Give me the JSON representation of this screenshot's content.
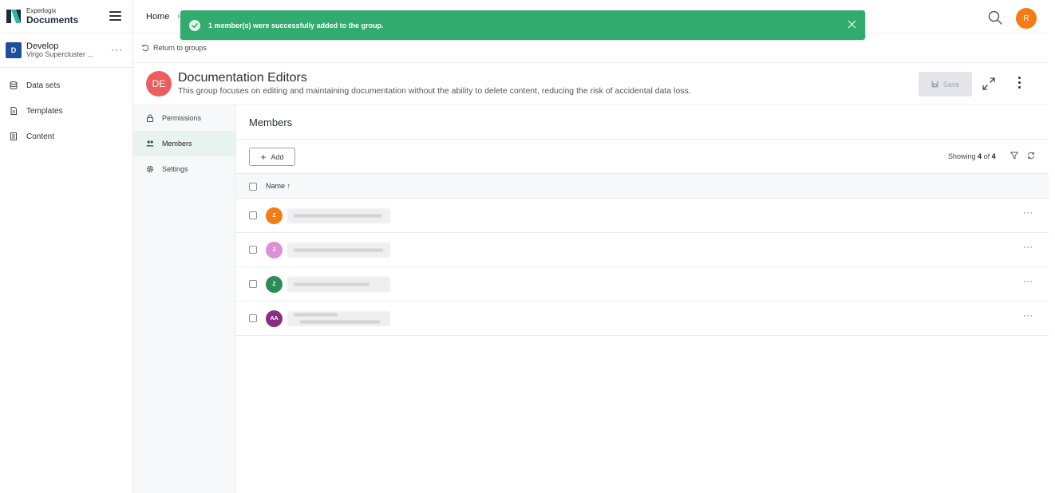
{
  "app": {
    "brand_small": "Experlogix",
    "brand_big": "Documents"
  },
  "workspace": {
    "badge": "D",
    "name": "Develop",
    "subtitle": "Virgo Supercluster ...",
    "more": "···"
  },
  "sidebar": {
    "items": [
      {
        "label": "Data sets",
        "icon": "database-icon"
      },
      {
        "label": "Templates",
        "icon": "document-icon"
      },
      {
        "label": "Content",
        "icon": "content-list-icon"
      }
    ]
  },
  "topbar": {
    "home_label": "Home",
    "home_sep": "›",
    "user_initial": "R",
    "user_color": "#f47b16"
  },
  "toast": {
    "message": "1 member(s) were successfully added to the group.",
    "color": "#32ab6e"
  },
  "return": {
    "label": "Return to groups"
  },
  "group": {
    "initials": "DE",
    "avatar_color": "#ec5e5e",
    "title": "Documentation Editors",
    "description": "This group focuses on editing and maintaining documentation without the ability to delete content, reducing the risk of accidental data loss.",
    "save_label": "Save"
  },
  "subnav": {
    "items": [
      {
        "label": "Permissions",
        "icon": "lock-icon",
        "active": false
      },
      {
        "label": "Members",
        "icon": "users-icon",
        "active": true
      },
      {
        "label": "Settings",
        "icon": "gear-icon",
        "active": false
      }
    ]
  },
  "members": {
    "title": "Members",
    "add_label": "Add",
    "add_plus": "+",
    "showing_prefix": "Showing",
    "showing_count": "4",
    "showing_of": "of",
    "showing_total": "4",
    "column_name": "Name ↑",
    "rows": [
      {
        "initials": "Z",
        "color": "#f47b16"
      },
      {
        "initials": "Z",
        "color": "#df8fd6"
      },
      {
        "initials": "Z",
        "color": "#2e8a57"
      },
      {
        "initials": "AA",
        "color": "#8a2d82"
      }
    ],
    "row_more": "···"
  }
}
